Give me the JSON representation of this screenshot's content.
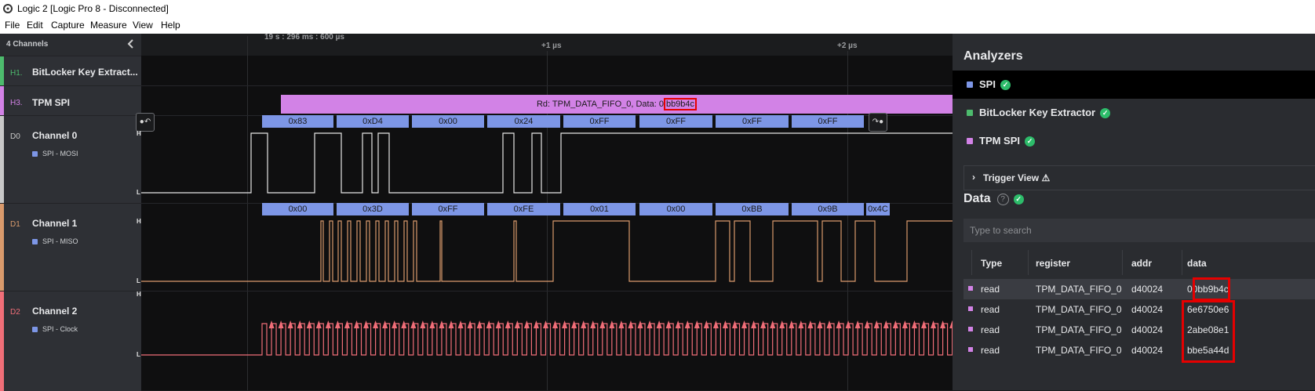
{
  "window": {
    "title": "Logic 2 [Logic Pro 8 - Disconnected]"
  },
  "menu": [
    "File",
    "Edit",
    "Capture",
    "Measure",
    "View",
    "Help"
  ],
  "sidebar": {
    "header": "4 Channels",
    "channels": [
      {
        "code": "H1.",
        "name": "BitLocker Key Extract...",
        "color": "#4dbb6d"
      },
      {
        "code": "H3.",
        "name": "TPM SPI",
        "color": "#d282e6"
      },
      {
        "code": "D0",
        "name": "Channel 0",
        "sub": "SPI - MOSI",
        "color": "#c8c8c8"
      },
      {
        "code": "D1",
        "name": "Channel 1",
        "sub": "SPI - MISO",
        "color": "#d99a6c"
      },
      {
        "code": "D2",
        "name": "Channel 2",
        "sub": "SPI - Clock",
        "color": "#f06e78"
      }
    ]
  },
  "timeline": {
    "start": "19 s : 296 ms : 600 µs",
    "mark1": "+1 µs",
    "mark2": "+2 µs"
  },
  "waveform": {
    "tpm_label_prefix": "Rd: TPM_DATA_FIFO_0, Data: 0",
    "tpm_label_highlight": "bb9b4c",
    "mosi_bytes": [
      "0x83",
      "0xD4",
      "0x00",
      "0x24",
      "0xFF",
      "0xFF",
      "0xFF",
      "0xFF"
    ],
    "miso_bytes": [
      "0x00",
      "0x3D",
      "0xFF",
      "0xFE",
      "0x01",
      "0x00",
      "0xBB",
      "0x9B",
      "0x4C"
    ],
    "level_high": "H",
    "level_low": "L"
  },
  "analyzers": {
    "title": "Analyzers",
    "items": [
      {
        "name": "SPI",
        "color": "#7d96e6"
      },
      {
        "name": "BitLocker Key Extractor",
        "color": "#4dbb6d"
      },
      {
        "name": "TPM SPI",
        "color": "#d282e6"
      }
    ],
    "trigger_view": "Trigger View",
    "trigger_warning": "⚠"
  },
  "data": {
    "title": "Data",
    "search_placeholder": "Type to search",
    "columns": [
      "Type",
      "register",
      "addr",
      "data"
    ],
    "rows": [
      {
        "type": "read",
        "register": "TPM_DATA_FIFO_0",
        "addr": "d40024",
        "data": "00bb9b4c"
      },
      {
        "type": "read",
        "register": "TPM_DATA_FIFO_0",
        "addr": "d40024",
        "data": "6e6750e6"
      },
      {
        "type": "read",
        "register": "TPM_DATA_FIFO_0",
        "addr": "d40024",
        "data": "2abe08e1"
      },
      {
        "type": "read",
        "register": "TPM_DATA_FIFO_0",
        "addr": "d40024",
        "data": "bbe5a44d"
      }
    ]
  },
  "colors": {
    "highlight": "#e60000",
    "check": "#2dbc6a"
  }
}
